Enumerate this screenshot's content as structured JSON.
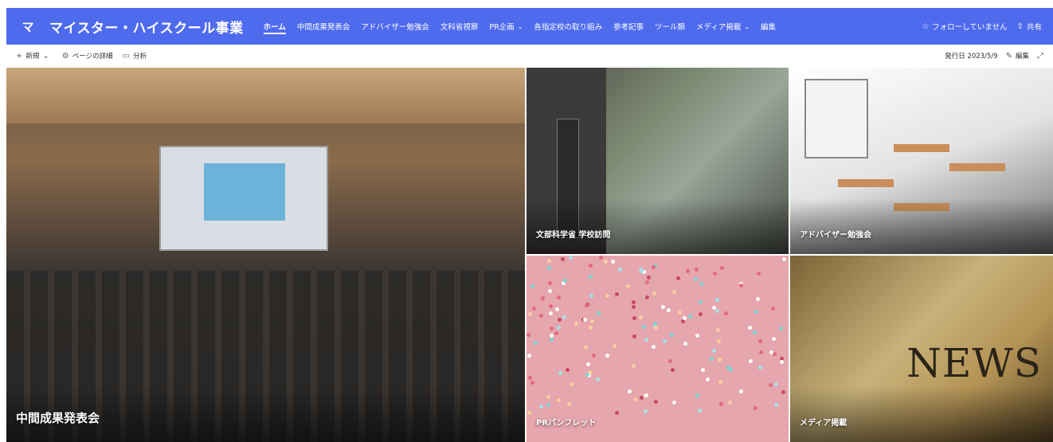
{
  "site": {
    "logo_letter": "マ",
    "title": "マイスター・ハイスクール事業"
  },
  "nav": {
    "items": [
      {
        "label": "ホーム",
        "active": true,
        "dropdown": false
      },
      {
        "label": "中間成果発表会",
        "active": false,
        "dropdown": false
      },
      {
        "label": "アドバイザー勉強会",
        "active": false,
        "dropdown": false
      },
      {
        "label": "文科省視察",
        "active": false,
        "dropdown": false
      },
      {
        "label": "PR企画",
        "active": false,
        "dropdown": true
      },
      {
        "label": "各指定校の取り組み",
        "active": false,
        "dropdown": false
      },
      {
        "label": "参考記事",
        "active": false,
        "dropdown": false
      },
      {
        "label": "ツール類",
        "active": false,
        "dropdown": false
      },
      {
        "label": "メディア掲載",
        "active": false,
        "dropdown": true
      },
      {
        "label": "編集",
        "active": false,
        "dropdown": false
      }
    ]
  },
  "header_actions": {
    "follow_label": "フォローしていません",
    "share_label": "共有"
  },
  "command_bar": {
    "new_label": "新規",
    "page_details_label": "ページの詳細",
    "analytics_label": "分析",
    "published_label": "発行日 2023/5/9",
    "edit_label": "編集"
  },
  "hero": {
    "tiles": [
      {
        "label": "中間成果発表会"
      },
      {
        "label": "文部科学省 学校訪問"
      },
      {
        "label": "アドバイザー勉強会"
      },
      {
        "label": "PRパンフレット"
      },
      {
        "label": "メディア掲載"
      }
    ],
    "media_image_text": "NEWS"
  },
  "colors": {
    "header_bg": "#4f6bed",
    "pr_tile_bg": "#e5a6ad"
  }
}
